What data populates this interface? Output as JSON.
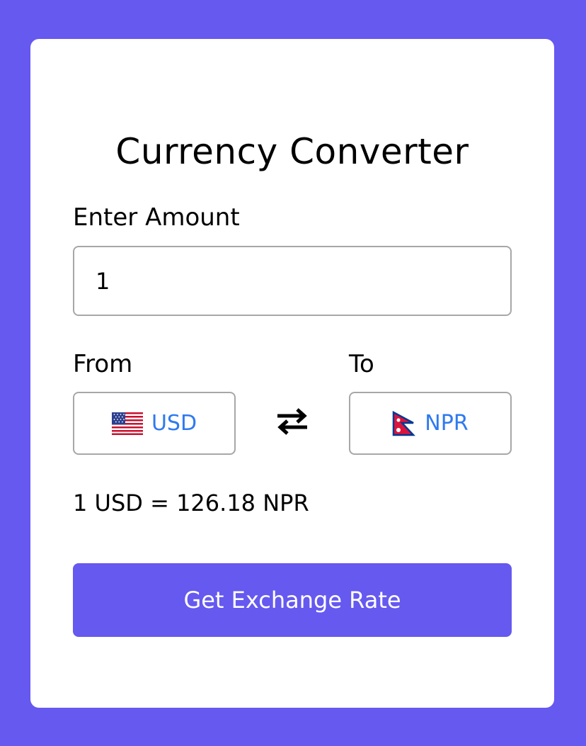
{
  "app": {
    "title": "Currency Converter"
  },
  "colors": {
    "background": "#6559f0",
    "card": "#ffffff",
    "accent": "#6559f0",
    "currency_text": "#2f7af0",
    "border": "#a7a7a7"
  },
  "amount": {
    "label": "Enter Amount",
    "value": "1"
  },
  "from": {
    "label": "From",
    "currency": "USD",
    "flag_icon": "us-flag-icon"
  },
  "to": {
    "label": "To",
    "currency": "NPR",
    "flag_icon": "nepal-flag-icon"
  },
  "swap": {
    "icon": "swap-arrows-icon"
  },
  "rate": {
    "text": "1 USD = 126.18 NPR"
  },
  "action": {
    "label": "Get Exchange Rate"
  }
}
